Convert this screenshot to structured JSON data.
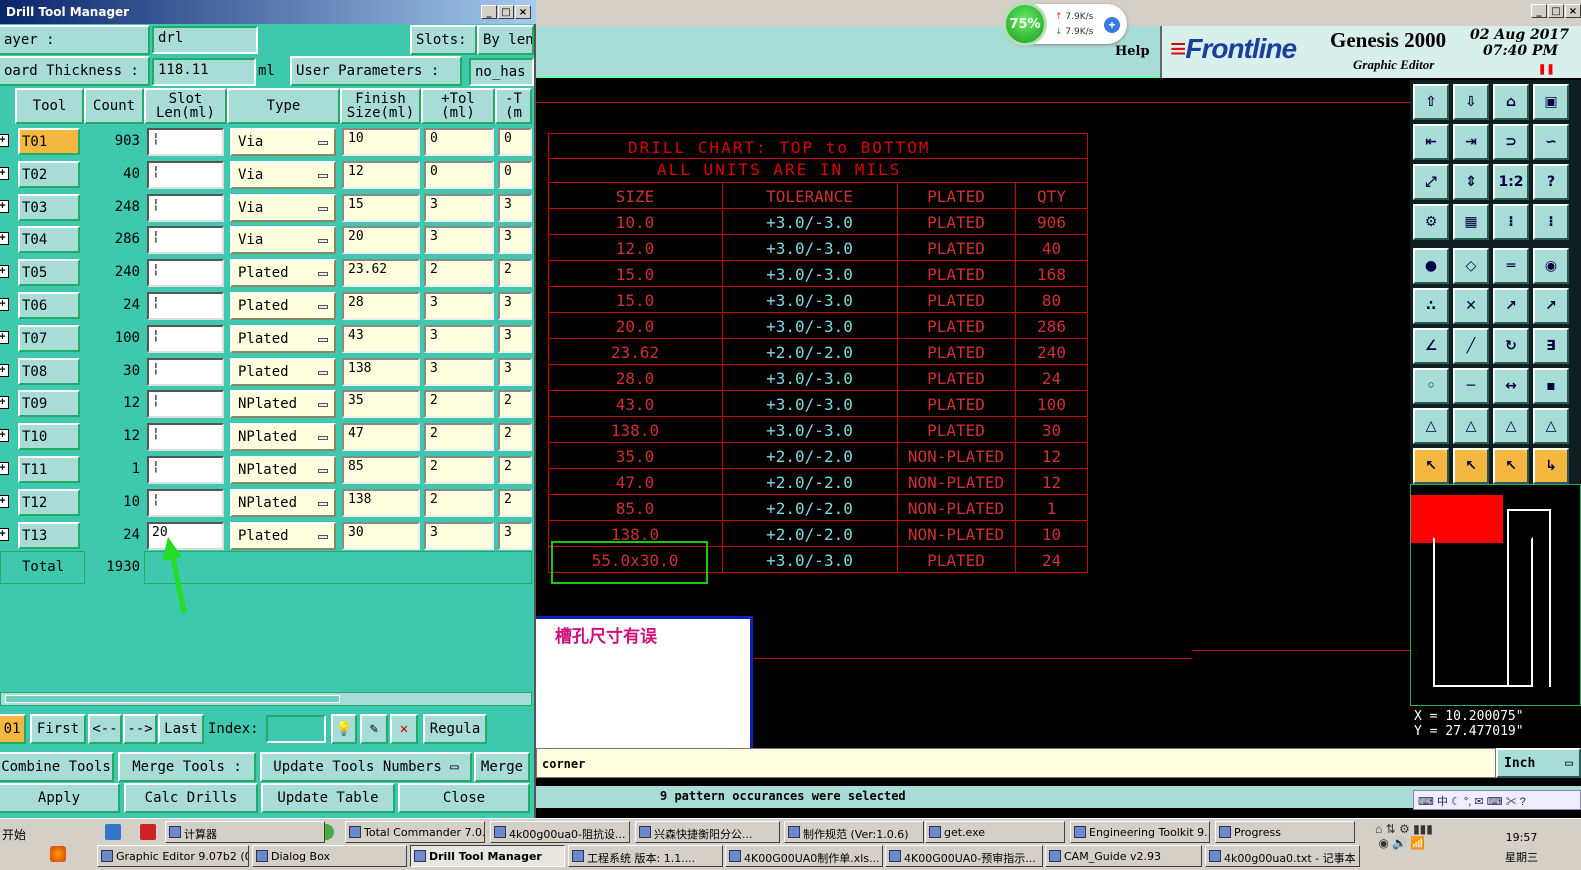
{
  "editor": {
    "help": "Help",
    "brand": "Frontline",
    "product": "Genesis 2000",
    "subtitle": "Graphic Editor",
    "date": "02 Aug 2017",
    "time": "07:40 PM"
  },
  "net_meter": {
    "percent": "75%",
    "up": "7.9K/s",
    "down": "7.9K/s"
  },
  "drill_chart": {
    "title1": "DRILL CHART: TOP to BOTTOM",
    "title2": "ALL UNITS ARE IN MILS",
    "headers": [
      "SIZE",
      "TOLERANCE",
      "PLATED",
      "QTY"
    ],
    "rows": [
      [
        "10.0",
        "+3.0/-3.0",
        "PLATED",
        "906"
      ],
      [
        "12.0",
        "+3.0/-3.0",
        "PLATED",
        "40"
      ],
      [
        "15.0",
        "+3.0/-3.0",
        "PLATED",
        "168"
      ],
      [
        "15.0",
        "+3.0/-3.0",
        "PLATED",
        "80"
      ],
      [
        "20.0",
        "+3.0/-3.0",
        "PLATED",
        "286"
      ],
      [
        "23.62",
        "+2.0/-2.0",
        "PLATED",
        "240"
      ],
      [
        "28.0",
        "+3.0/-3.0",
        "PLATED",
        "24"
      ],
      [
        "43.0",
        "+3.0/-3.0",
        "PLATED",
        "100"
      ],
      [
        "138.0",
        "+3.0/-3.0",
        "PLATED",
        "30"
      ],
      [
        "35.0",
        "+2.0/-2.0",
        "NON-PLATED",
        "12"
      ],
      [
        "47.0",
        "+2.0/-2.0",
        "NON-PLATED",
        "12"
      ],
      [
        "85.0",
        "+2.0/-2.0",
        "NON-PLATED",
        "1"
      ],
      [
        "138.0",
        "+2.0/-2.0",
        "NON-PLATED",
        "10"
      ],
      [
        "55.0x30.0",
        "+3.0/-3.0",
        "PLATED",
        "24"
      ]
    ]
  },
  "note": "槽孔尺寸有误",
  "coords": {
    "x": "X = 10.200075\"",
    "y": "Y = 27.477019\""
  },
  "command": "corner",
  "units": "Inch",
  "status": "9 pattern occurances were selected",
  "dtm": {
    "title": "Drill Tool Manager",
    "layer_label": "ayer           :",
    "layer_value": "drl",
    "slots_label": "Slots:",
    "slots_value": "By len",
    "thickness_label": "oard Thickness :",
    "thickness_value": "118.11",
    "thickness_unit": "ml",
    "userparam_label": "User Parameters :",
    "userparam_value": "no_has",
    "headers": [
      "Tool",
      "Count",
      "Slot Len(ml)",
      "Type",
      "Finish Size(ml)",
      "+Tol (ml)",
      "-T (m"
    ],
    "rows": [
      {
        "tool": "T01",
        "count": "903",
        "slot": "",
        "type": "Via",
        "finish": "10",
        "ptol": "0",
        "ntol": "0"
      },
      {
        "tool": "T02",
        "count": "40",
        "slot": "",
        "type": "Via",
        "finish": "12",
        "ptol": "0",
        "ntol": "0"
      },
      {
        "tool": "T03",
        "count": "248",
        "slot": "",
        "type": "Via",
        "finish": "15",
        "ptol": "3",
        "ntol": "3"
      },
      {
        "tool": "T04",
        "count": "286",
        "slot": "",
        "type": "Via",
        "finish": "20",
        "ptol": "3",
        "ntol": "3"
      },
      {
        "tool": "T05",
        "count": "240",
        "slot": "",
        "type": "Plated",
        "finish": "23.62",
        "ptol": "2",
        "ntol": "2"
      },
      {
        "tool": "T06",
        "count": "24",
        "slot": "",
        "type": "Plated",
        "finish": "28",
        "ptol": "3",
        "ntol": "3"
      },
      {
        "tool": "T07",
        "count": "100",
        "slot": "",
        "type": "Plated",
        "finish": "43",
        "ptol": "3",
        "ntol": "3"
      },
      {
        "tool": "T08",
        "count": "30",
        "slot": "",
        "type": "Plated",
        "finish": "138",
        "ptol": "3",
        "ntol": "3"
      },
      {
        "tool": "T09",
        "count": "12",
        "slot": "",
        "type": "NPlated",
        "finish": "35",
        "ptol": "2",
        "ntol": "2"
      },
      {
        "tool": "T10",
        "count": "12",
        "slot": "",
        "type": "NPlated",
        "finish": "47",
        "ptol": "2",
        "ntol": "2"
      },
      {
        "tool": "T11",
        "count": "1",
        "slot": "",
        "type": "NPlated",
        "finish": "85",
        "ptol": "2",
        "ntol": "2"
      },
      {
        "tool": "T12",
        "count": "10",
        "slot": "",
        "type": "NPlated",
        "finish": "138",
        "ptol": "2",
        "ntol": "2"
      },
      {
        "tool": "T13",
        "count": "24",
        "slot": "20",
        "type": "Plated",
        "finish": "30",
        "ptol": "3",
        "ntol": "3"
      }
    ],
    "total_label": "Total",
    "total_value": "1930",
    "nav": {
      "index_num": "01",
      "first": "First",
      "prev": "<--",
      "next": "-->",
      "last": "Last",
      "index_label": "Index:",
      "regular": "Regula"
    },
    "actions1": {
      "combine": "Combine Tools",
      "merge_label": "Merge Tools :",
      "update_numbers": "Update Tools Numbers",
      "merge": "Merge"
    },
    "actions2": {
      "apply": "Apply",
      "calc": "Calc Drills",
      "update_table": "Update Table",
      "close": "Close"
    }
  },
  "taskbar": {
    "start": "开始",
    "row1": [
      "计算器",
      "Total Commander 7.0...",
      "4k00g00ua0-阻抗设...",
      "兴森快捷衡阳分公...",
      "制作规范 (Ver:1.0.6)",
      "get.exe",
      "Engineering Toolkit 9....",
      "Progress"
    ],
    "row2": [
      "Graphic Editor 9.07b2 (0...",
      "Dialog Box",
      "Drill Tool Manager",
      "工程系统  版本: 1.1....",
      "4K00G00UA0制作单.xls...",
      "4K00G00UA0-预审指示...",
      "CAM_Guide v2.93",
      "4k00g00ua0.txt - 记事本"
    ],
    "time": "19:57",
    "day": "星期三"
  }
}
